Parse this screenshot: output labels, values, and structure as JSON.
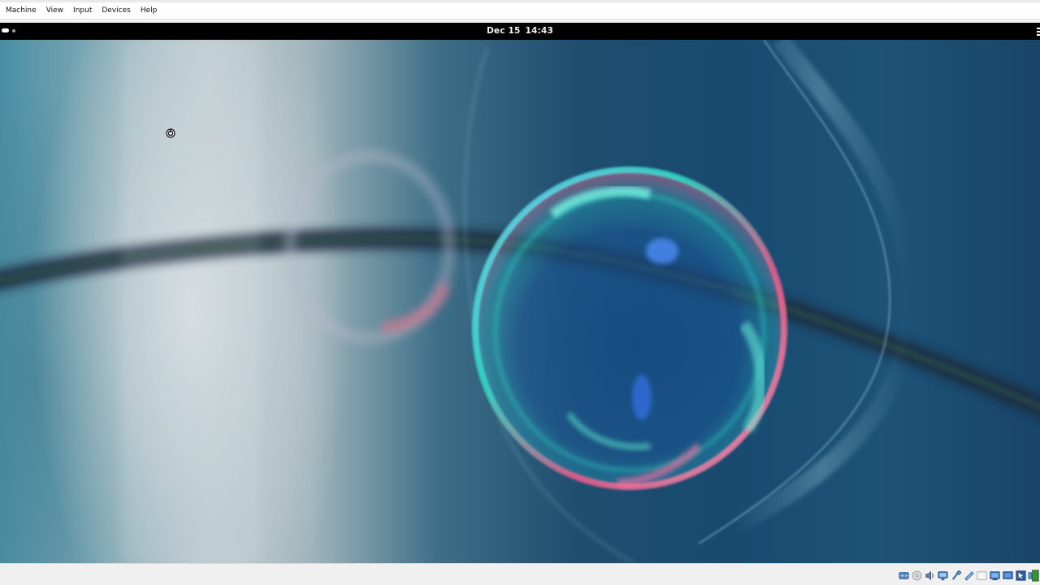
{
  "host_window": {
    "menu": [
      {
        "label": "Machine"
      },
      {
        "label": "View"
      },
      {
        "label": "Input"
      },
      {
        "label": "Devices"
      },
      {
        "label": "Help"
      }
    ]
  },
  "guest_panel": {
    "date": "Dec 15",
    "time": "14:43",
    "workspace_indicator": {
      "active": 1,
      "total": 2
    },
    "tray_icon": "system-menu-icon"
  },
  "desktop": {
    "wallpaper": "bubble-abstract-wallpaper",
    "cursor_icon": "busy-cursor-icon"
  },
  "status_bar": {
    "icons": [
      "harddisk-icon",
      "optical-drive-icon",
      "audio-icon",
      "network-icon",
      "usb-icon",
      "shared-folders-icon",
      "display-icon",
      "video-capture-icon",
      "cpu-icon",
      "mouse-integration-icon",
      "host-key-icon"
    ]
  },
  "colors": {
    "panel_bg": "#000000",
    "menubar_bg": "#ffffff",
    "statusbar_bg": "#f0f0f0",
    "wallpaper_deep_blue": "#184a70",
    "wallpaper_teal": "#4a8ea3",
    "bubble_cyan": "#2ee0c8",
    "bubble_pink": "#f25a8a"
  }
}
